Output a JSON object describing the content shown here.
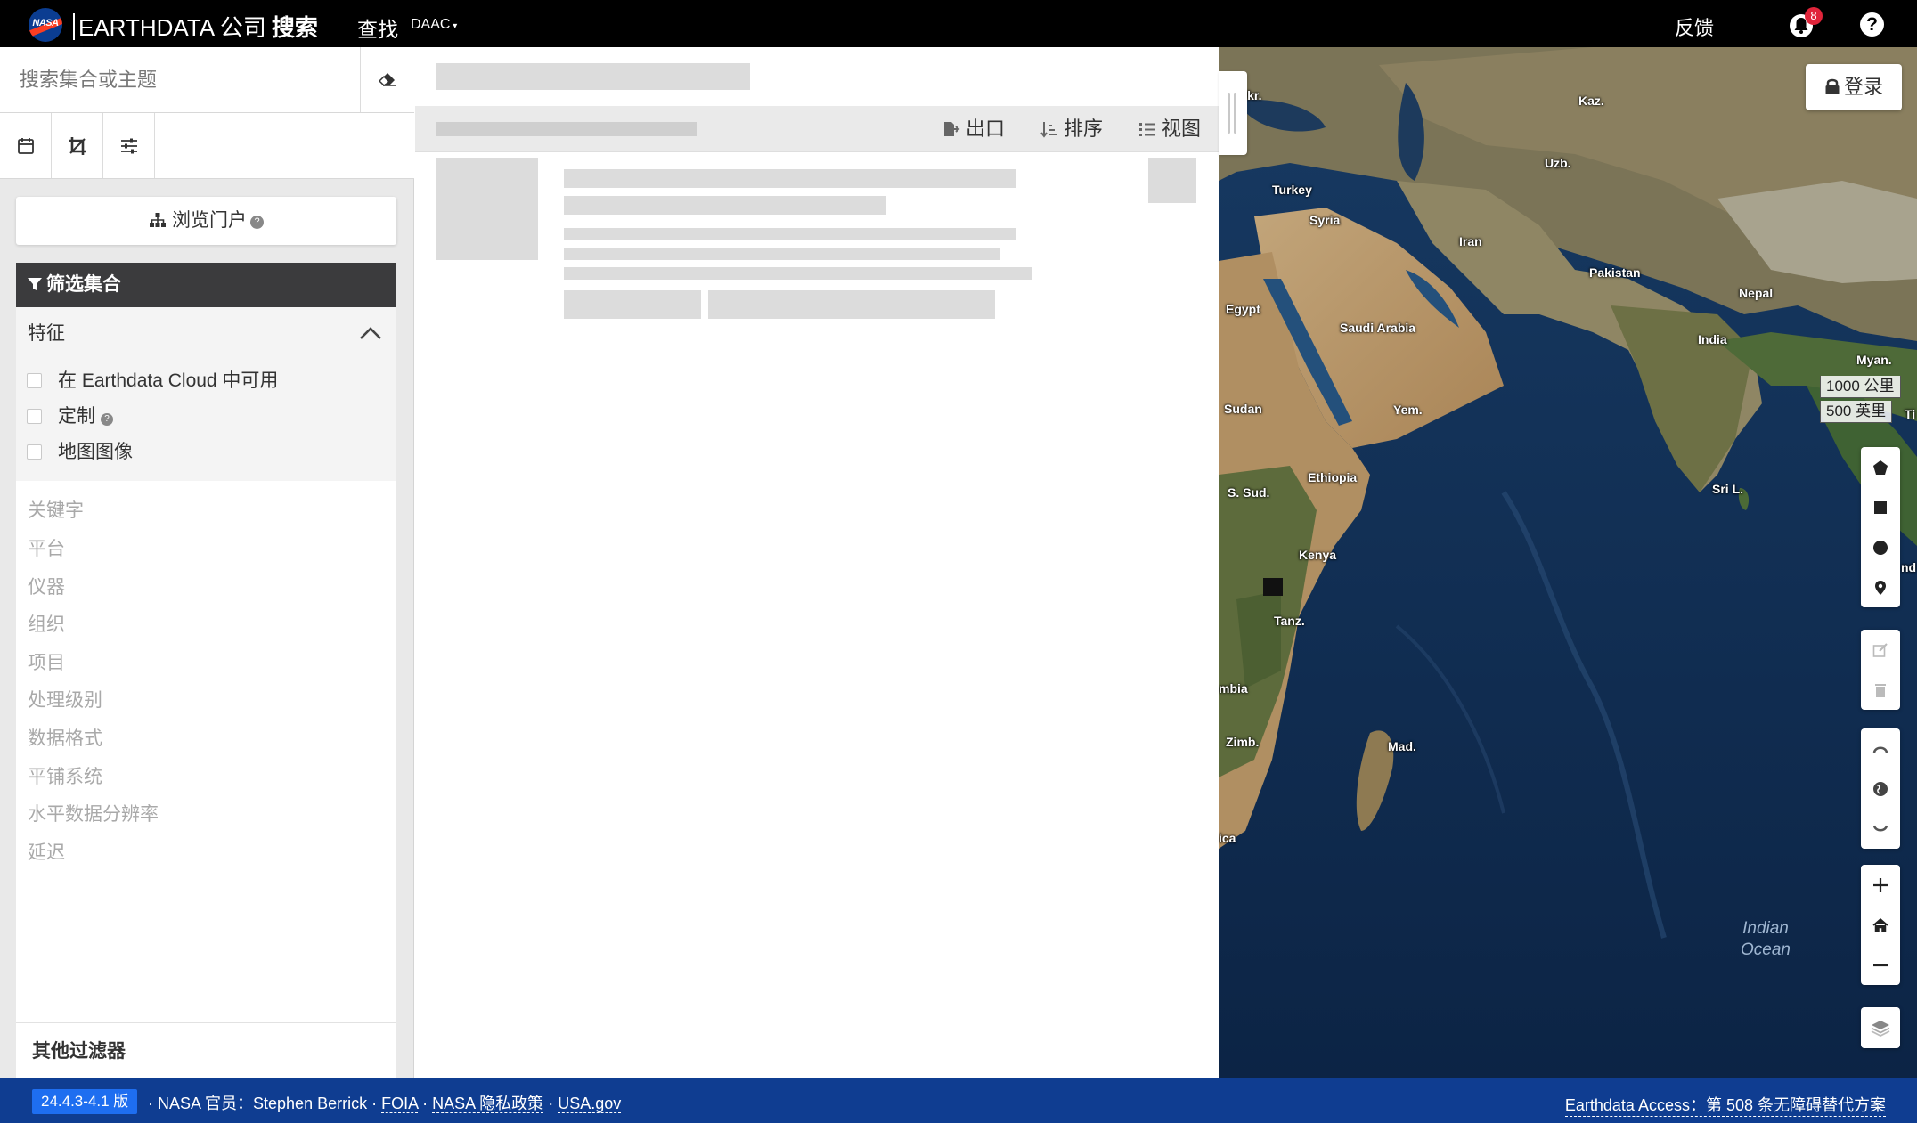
{
  "header": {
    "logo_text": "NASA",
    "brand": "EARTHDATA 公司",
    "brand_bold": "搜索",
    "find": "查找",
    "daac": "DAAC",
    "feedback": "反馈",
    "notification_count": "8",
    "help": "?"
  },
  "sidebar": {
    "search_placeholder": "搜索集合或主题",
    "browse_portals": "浏览门户",
    "filter_title": "筛选集合",
    "features": {
      "title": "特征",
      "items": [
        "在 Earthdata Cloud 中可用",
        "定制",
        "地图图像"
      ]
    },
    "facets": [
      "关键字",
      "平台",
      "仪器",
      "组织",
      "项目",
      "处理级别",
      "数据格式",
      "平铺系统",
      "水平数据分辨率",
      "延迟"
    ],
    "other_filters": "其他过滤器"
  },
  "results": {
    "toolbar": {
      "export": "出口",
      "sort": "排序",
      "view": "视图"
    }
  },
  "map": {
    "login": "登录",
    "scale_km": "1000 公里",
    "scale_mi": "500 英里",
    "labels": [
      "Ukr.",
      "Kaz.",
      "Uzb.",
      "Turkey",
      "Syria",
      "Iran",
      "Pakistan",
      "Nepal",
      "Egypt",
      "Saudi Arabia",
      "India",
      "Myan.",
      "Sudan",
      "Yem.",
      "Sri L.",
      "Ethiopia",
      "S. Sud.",
      "Kenya",
      "Tanz.",
      "mbia",
      "Zimb.",
      "Mad.",
      "ica",
      "nd",
      "Ti"
    ],
    "ocean": [
      "Indian",
      "Ocean"
    ]
  },
  "footer": {
    "version": "24.4.3-4.1 版",
    "official_label": "· NASA 官员：Stephen Berrick ·",
    "foia": "FOIA",
    "privacy": "NASA 隐私政策",
    "usa_gov": "USA.gov",
    "sep": "·",
    "accessibility": "Earthdata Access：第 508 条无障碍替代方案"
  },
  "colors": {
    "topbar": "#000000",
    "footer": "#0f3d91",
    "version_badge": "#1e6ef0",
    "filter_header": "#3b3b3d",
    "notification_badge": "#e0243a"
  }
}
